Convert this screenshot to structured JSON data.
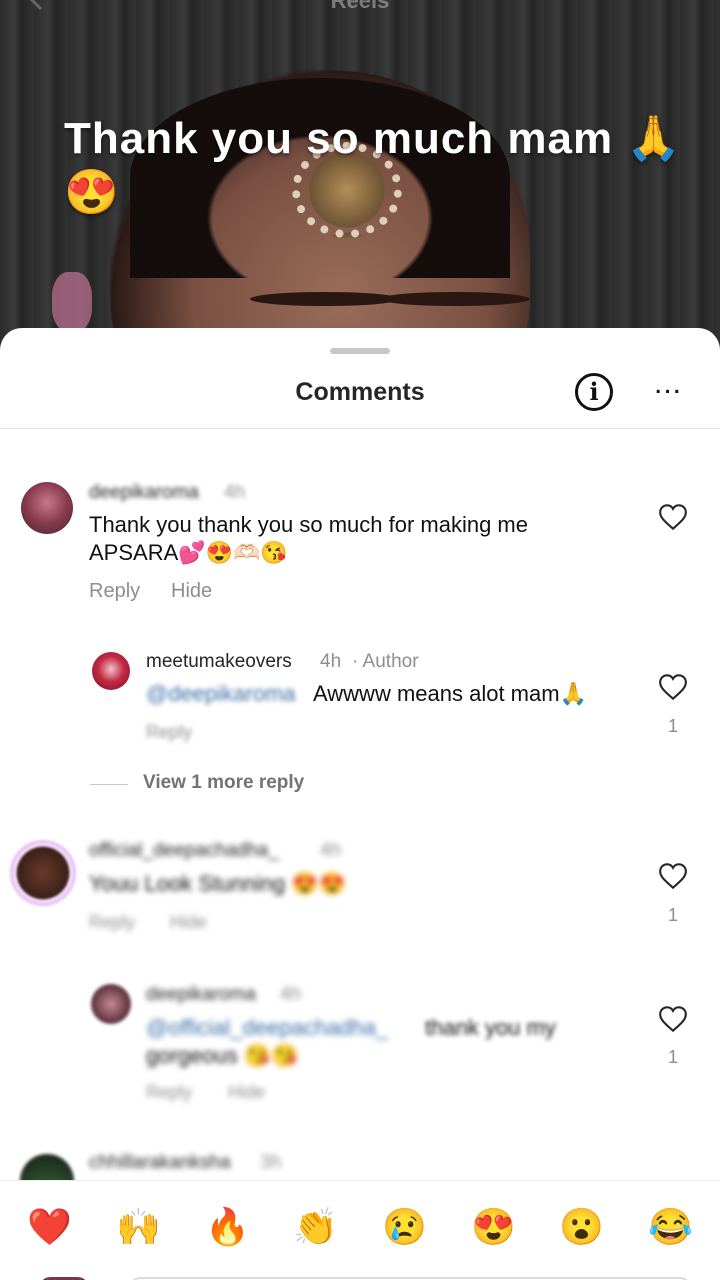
{
  "header": {
    "title": "Reels",
    "caption": "Thank you so much mam 🙏😍"
  },
  "sheet": {
    "title": "Comments"
  },
  "comments": [
    {
      "username": "deepikaroma",
      "time": "4h",
      "text": "Thank you thank you so much for making me APSARA💕😍🫶🏻😘",
      "reply_label": "Reply",
      "hide_label": "Hide"
    },
    {
      "username": "meetumakeovers",
      "time": "4h",
      "tag": "· Author",
      "mention": "@deepikaroma",
      "text": "Awwww means alot mam🙏",
      "reply_label": "Reply",
      "like_count": "1"
    },
    {
      "view_more": "View 1 more reply"
    },
    {
      "username": "official_deepachadha_",
      "time": "4h",
      "text": "Youu Look Stunning 😍😍",
      "reply_label": "Reply",
      "hide_label": "Hide",
      "like_count": "1"
    },
    {
      "username": "deepikaroma",
      "time": "4h",
      "mention": "@official_deepachadha_",
      "text": "thank you my",
      "text2": "gorgeous 😘😘",
      "reply_label": "Reply",
      "hide_label": "Hide",
      "like_count": "1"
    },
    {
      "username": "chhillarakanksha",
      "time": "3h"
    }
  ],
  "reactions": [
    "❤️",
    "🙌",
    "🔥",
    "👏",
    "😢",
    "😍",
    "😮",
    "😂"
  ],
  "colors": {
    "text": "#262626",
    "muted": "#8e8e8e",
    "sheet_bg": "#ffffff"
  }
}
